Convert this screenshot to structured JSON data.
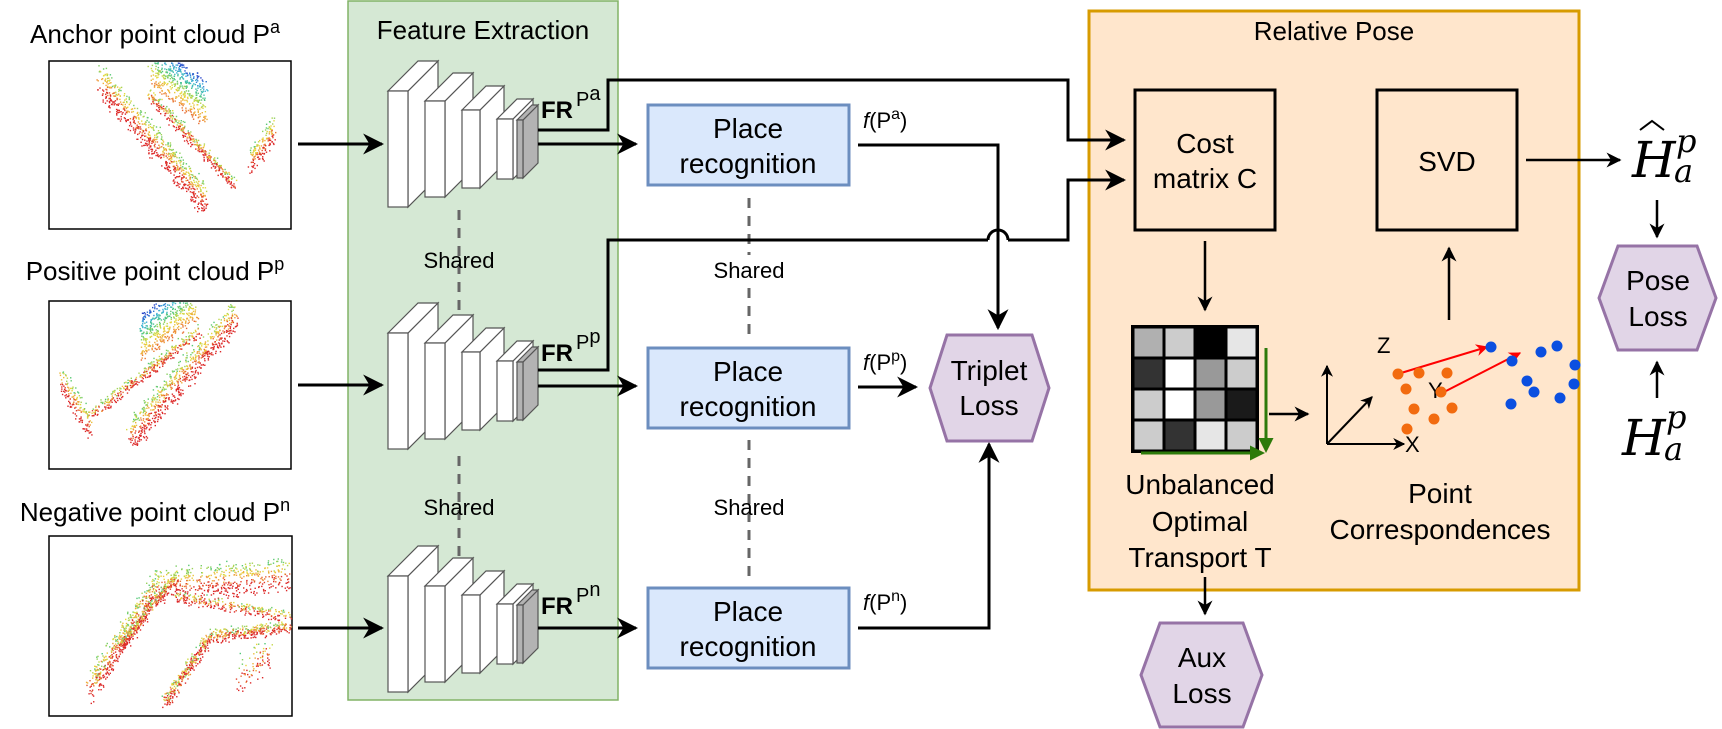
{
  "inputs": [
    {
      "label": "Anchor point cloud P",
      "sup": "a",
      "kind": "anchor"
    },
    {
      "label": "Positive point cloud P",
      "sup": "p",
      "kind": "positive"
    },
    {
      "label": "Negative point cloud P",
      "sup": "n",
      "kind": "negative"
    }
  ],
  "feature_extraction": {
    "title": "Feature Extraction",
    "shared_labels": [
      "Shared",
      "Shared"
    ],
    "outputs": [
      {
        "base": "FR",
        "sup": "P",
        "supsup": "a"
      },
      {
        "base": "FR",
        "sup": "P",
        "supsup": "p"
      },
      {
        "base": "FR",
        "sup": "P",
        "supsup": "n"
      }
    ]
  },
  "place_recognition": {
    "boxes": [
      {
        "line1": "Place",
        "line2": "recognition"
      },
      {
        "line1": "Place",
        "line2": "recognition"
      },
      {
        "line1": "Place",
        "line2": "recognition"
      }
    ],
    "shared_labels": [
      "Shared",
      "Shared"
    ],
    "outputs": [
      {
        "fn": "f",
        "arg": "(P",
        "sup": "a",
        "close": ")"
      },
      {
        "fn": "f",
        "arg": "(P",
        "sup": "p",
        "close": ")"
      },
      {
        "fn": "f",
        "arg": "(P",
        "sup": "n",
        "close": ")"
      }
    ]
  },
  "losses": {
    "triplet": {
      "line1": "Triplet",
      "line2": "Loss"
    },
    "aux": {
      "line1": "Aux",
      "line2": "Loss"
    },
    "pose": {
      "line1": "Pose",
      "line2": "Loss"
    }
  },
  "relative_pose": {
    "title": "Relative Pose",
    "cost_matrix": {
      "line1": "Cost",
      "line2": "matrix C"
    },
    "svd": {
      "label": "SVD"
    },
    "transport": {
      "line1": "Unbalanced",
      "line2": "Optimal",
      "line3": "Transport T"
    },
    "transport_matrix": {
      "cells": [
        [
          "#b0b0b0",
          "#cccccc",
          "#000000",
          "#e6e6e6"
        ],
        [
          "#333333",
          "#ffffff",
          "#999999",
          "#cccccc"
        ],
        [
          "#cccccc",
          "#ffffff",
          "#999999",
          "#1a1a1a"
        ],
        [
          "#cccccc",
          "#333333",
          "#e6e6e6",
          "#cccccc"
        ]
      ]
    },
    "correspondences": {
      "line1": "Point",
      "line2": "Correspondences",
      "axes": {
        "x": "X",
        "y": "Y",
        "z": "Z"
      }
    }
  },
  "pose_outputs": {
    "estimated": {
      "base": "H",
      "sub": "a",
      "sup": "p",
      "hat": true
    },
    "ground_truth": {
      "base": "H",
      "sub": "a",
      "sup": "p",
      "hat": false
    }
  },
  "colors": {
    "feature_bg": "#d5e8d4",
    "feature_border": "#82b366",
    "place_bg": "#dae8fc",
    "place_border": "#6c8ebf",
    "pose_bg": "#ffe6cc",
    "pose_border": "#d79b00",
    "loss_bg": "#e1d5e7",
    "loss_border": "#9673a6",
    "source_points": "#f26b0f",
    "target_points": "#0b4fe0",
    "corr_arrow": "#ff0000",
    "transport_arrow": "#2d7a0a"
  }
}
